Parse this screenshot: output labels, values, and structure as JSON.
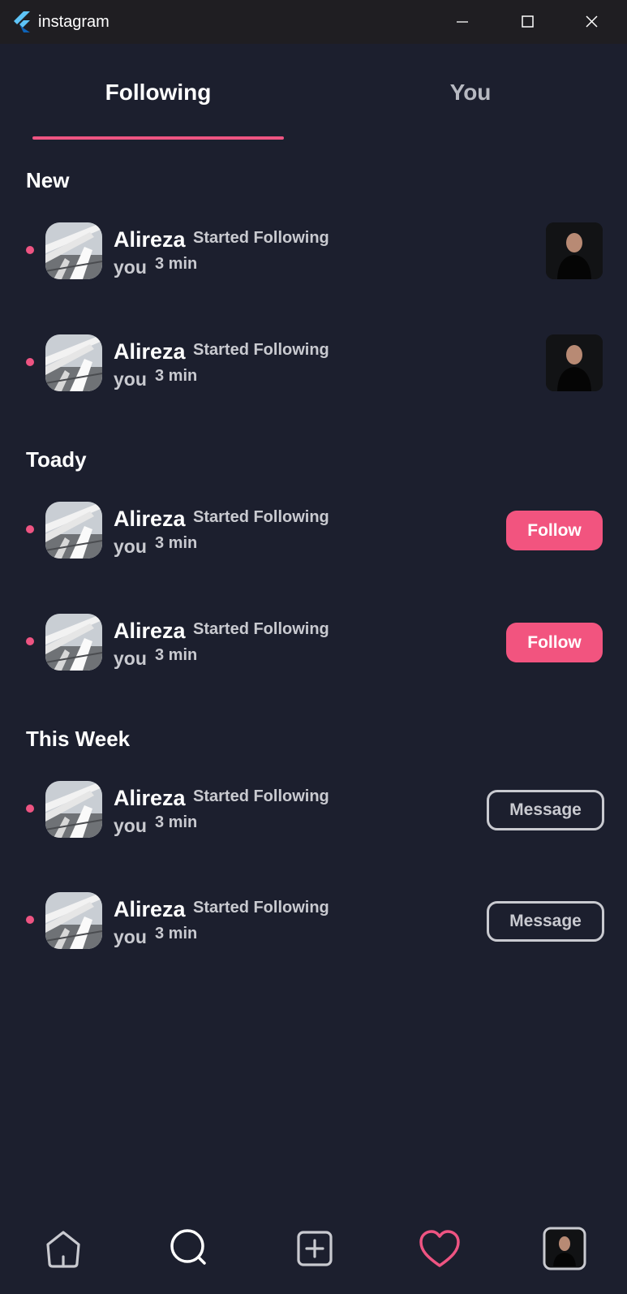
{
  "window": {
    "title": "instagram",
    "logo_icon": "flutter-logo-icon",
    "controls": [
      "minimize-icon",
      "maximize-icon",
      "close-icon"
    ]
  },
  "tabs": [
    {
      "label": "Following",
      "active": true
    },
    {
      "label": "You",
      "active": false
    }
  ],
  "colors": {
    "background": "#1c1f2e",
    "accent": "#ee5482",
    "follow_button": "#f2547f",
    "muted_text": "#c9cad0"
  },
  "sections": [
    {
      "title": "New",
      "items": [
        {
          "name": "Alireza",
          "action": "Started Following",
          "you": "you",
          "time": "3 min",
          "trailing": "post-thumbnail"
        },
        {
          "name": "Alireza",
          "action": "Started Following",
          "you": "you",
          "time": "3 min",
          "trailing": "post-thumbnail"
        }
      ]
    },
    {
      "title": "Toady",
      "items": [
        {
          "name": "Alireza",
          "action": "Started Following",
          "you": "you",
          "time": "3 min",
          "trailing": "button",
          "button_label": "Follow"
        },
        {
          "name": "Alireza",
          "action": "Started Following",
          "you": "you",
          "time": "3 min",
          "trailing": "button",
          "button_label": "Follow"
        }
      ]
    },
    {
      "title": "This Week",
      "items": [
        {
          "name": "Alireza",
          "action": "Started Following",
          "you": "you",
          "time": "3 min",
          "trailing": "button",
          "button_label": "Message"
        },
        {
          "name": "Alireza",
          "action": "Started Following",
          "you": "you",
          "time": "3 min",
          "trailing": "button",
          "button_label": "Message"
        }
      ]
    }
  ],
  "bottom_nav": {
    "items": [
      "home-icon",
      "search-icon",
      "add-post-icon",
      "heart-icon",
      "profile-avatar"
    ],
    "active": "heart-icon"
  }
}
